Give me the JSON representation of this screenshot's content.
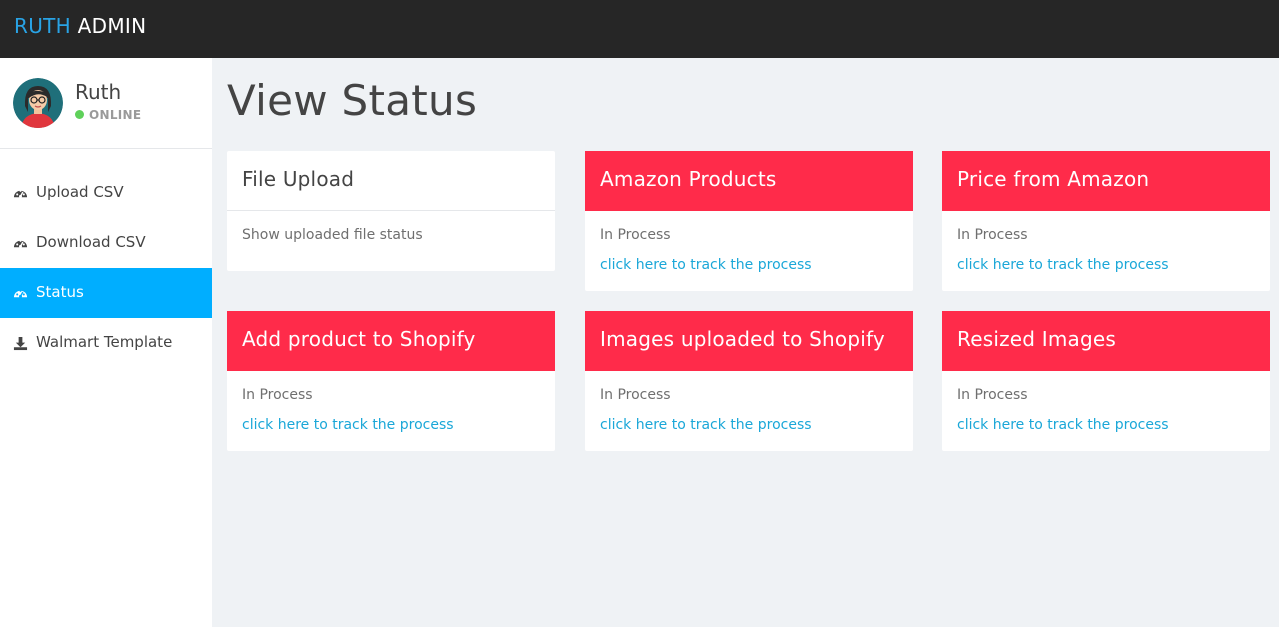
{
  "brand": {
    "part1": "RUTH",
    "part2": "ADMIN"
  },
  "profile": {
    "name": "Ruth",
    "status": "ONLINE"
  },
  "nav": [
    {
      "label": "Upload CSV",
      "icon": "dashboard-icon",
      "active": false
    },
    {
      "label": "Download CSV",
      "icon": "dashboard-icon",
      "active": false
    },
    {
      "label": "Status",
      "icon": "dashboard-icon",
      "active": true
    },
    {
      "label": "Walmart Template",
      "icon": "download-icon",
      "active": false
    }
  ],
  "page": {
    "title": "View Status"
  },
  "cards": [
    {
      "title": "File Upload",
      "status": "Show uploaded file status",
      "link": ""
    },
    {
      "title": "Amazon Products",
      "status": "In Process",
      "link": "click here to track the process"
    },
    {
      "title": "Price from Amazon",
      "status": "In Process",
      "link": "click here to track the process"
    },
    {
      "title": "Add product to Shopify",
      "status": "In Process",
      "link": "click here to track the process"
    },
    {
      "title": "Images uploaded to Shopify",
      "status": "In Process",
      "link": "click here to track the process"
    },
    {
      "title": "Resized Images",
      "status": "In Process",
      "link": "click here to track the process"
    }
  ],
  "colors": {
    "topbar": "#262626",
    "accent": "#29a3e5",
    "active_nav": "#00aeff",
    "card_header": "#ff2b4a",
    "online": "#5fd15a",
    "link": "#1aa7d8"
  }
}
